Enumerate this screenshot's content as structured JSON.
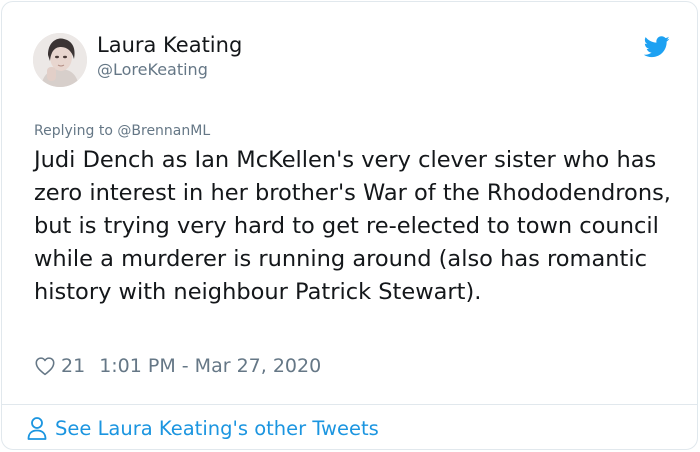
{
  "tweet": {
    "author": {
      "name": "Laura Keating",
      "handle": "@LoreKeating",
      "avatar_icon": "avatar-photo"
    },
    "brand_icon": "twitter-bird-icon",
    "reply_prefix": "Replying to",
    "reply_to": "@BrennanML",
    "text": "Judi Dench as Ian McKellen's very clever sister who has zero interest in her brother's War of the Rhododendrons, but is trying very hard to get re-elected to town council while a murderer is running around (also has romantic history with neighbour Patrick Stewart).",
    "likes": "21",
    "like_icon": "heart-icon",
    "timestamp": "1:01 PM - Mar 27, 2020"
  },
  "footer": {
    "link_text": "See Laura Keating's other Tweets",
    "icon": "person-icon"
  },
  "colors": {
    "brand_blue": "#1da1f2",
    "link_blue": "#1b95e0",
    "secondary_text": "#657786",
    "primary_text": "#14171a",
    "border": "#e1e8ed"
  }
}
